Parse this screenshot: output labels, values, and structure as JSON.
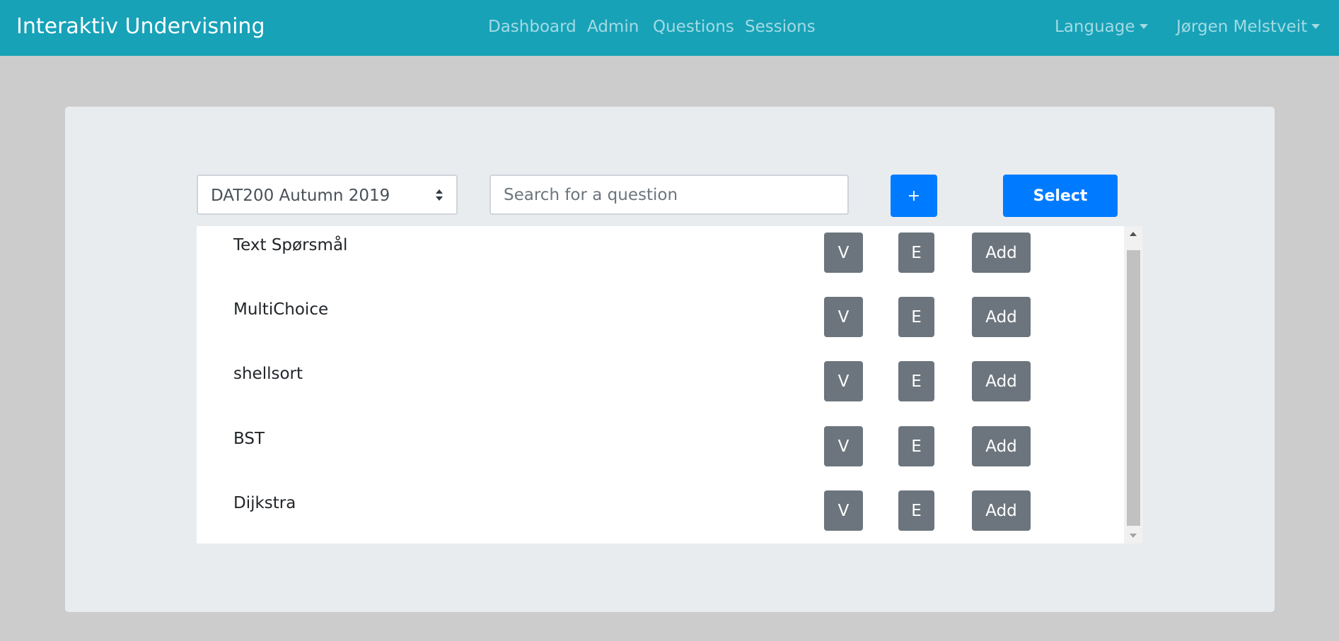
{
  "navbar": {
    "brand": "Interaktiv Undervisning",
    "links": [
      "Dashboard",
      "Admin",
      "Questions",
      "Sessions"
    ],
    "language_label": "Language",
    "user_label": "Jørgen Melstveit",
    "background_color": "#17a2b8"
  },
  "toolbar": {
    "course_selected": "DAT200 Autumn 2019",
    "search_placeholder": "Search for a question",
    "plus_label": "+",
    "select_label": "Select"
  },
  "questions": [
    {
      "title": "Text Spørsmål",
      "view_label": "V",
      "edit_label": "E",
      "add_label": "Add"
    },
    {
      "title": "MultiChoice",
      "view_label": "V",
      "edit_label": "E",
      "add_label": "Add"
    },
    {
      "title": "shellsort",
      "view_label": "V",
      "edit_label": "E",
      "add_label": "Add"
    },
    {
      "title": "BST",
      "view_label": "V",
      "edit_label": "E",
      "add_label": "Add"
    },
    {
      "title": "Dijkstra",
      "view_label": "V",
      "edit_label": "E",
      "add_label": "Add"
    }
  ],
  "colors": {
    "primary": "#007bff",
    "secondary": "#6c757d",
    "page_bg": "#cccccc",
    "card_bg": "#e9ecef"
  }
}
